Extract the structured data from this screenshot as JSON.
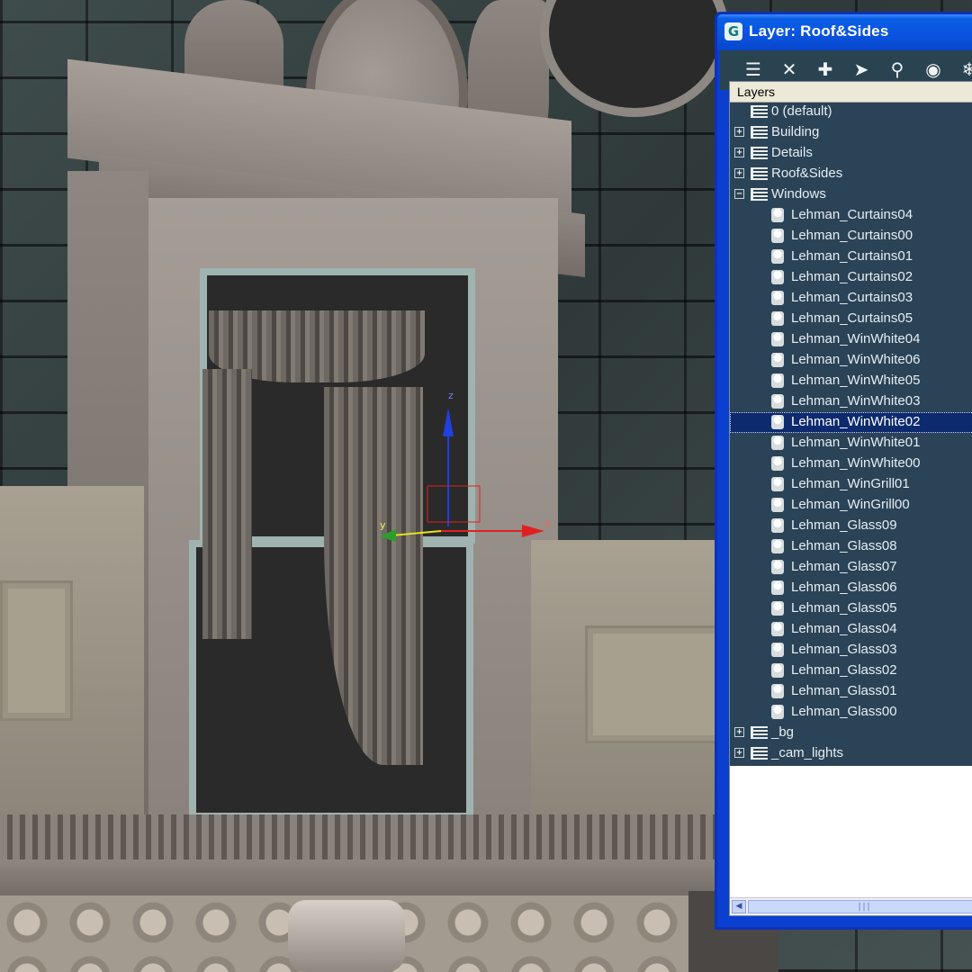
{
  "window": {
    "title": "Layer: Roof&Sides",
    "app_icon": "3dsmax-logo-icon"
  },
  "toolbar": {
    "tools": [
      {
        "name": "create-layer-icon",
        "glyph": "☰"
      },
      {
        "name": "delete-layer-icon",
        "glyph": "✕"
      },
      {
        "name": "add-selection-icon",
        "glyph": "✚"
      },
      {
        "name": "select-objects-icon",
        "glyph": "➤"
      },
      {
        "name": "highlight-selected-icon",
        "glyph": "⚲"
      },
      {
        "name": "hide-all-icon",
        "glyph": "◉"
      },
      {
        "name": "freeze-all-icon",
        "glyph": "❄"
      }
    ]
  },
  "tree": {
    "column_header": "Layers",
    "selected_index": 15,
    "rows": [
      {
        "type": "layer",
        "label": "0 (default)",
        "expander": ""
      },
      {
        "type": "layer",
        "label": "Building",
        "expander": "+"
      },
      {
        "type": "layer",
        "label": "Details",
        "expander": "+"
      },
      {
        "type": "layer",
        "label": "Roof&Sides",
        "expander": "+"
      },
      {
        "type": "layer",
        "label": "Windows",
        "expander": "−"
      },
      {
        "type": "object",
        "label": "Lehman_Curtains04"
      },
      {
        "type": "object",
        "label": "Lehman_Curtains00"
      },
      {
        "type": "object",
        "label": "Lehman_Curtains01"
      },
      {
        "type": "object",
        "label": "Lehman_Curtains02"
      },
      {
        "type": "object",
        "label": "Lehman_Curtains03"
      },
      {
        "type": "object",
        "label": "Lehman_Curtains05"
      },
      {
        "type": "object",
        "label": "Lehman_WinWhite04"
      },
      {
        "type": "object",
        "label": "Lehman_WinWhite06"
      },
      {
        "type": "object",
        "label": "Lehman_WinWhite05"
      },
      {
        "type": "object",
        "label": "Lehman_WinWhite03"
      },
      {
        "type": "object",
        "label": "Lehman_WinWhite02"
      },
      {
        "type": "object",
        "label": "Lehman_WinWhite01"
      },
      {
        "type": "object",
        "label": "Lehman_WinWhite00"
      },
      {
        "type": "object",
        "label": "Lehman_WinGrill01"
      },
      {
        "type": "object",
        "label": "Lehman_WinGrill00"
      },
      {
        "type": "object",
        "label": "Lehman_Glass09"
      },
      {
        "type": "object",
        "label": "Lehman_Glass08"
      },
      {
        "type": "object",
        "label": "Lehman_Glass07"
      },
      {
        "type": "object",
        "label": "Lehman_Glass06"
      },
      {
        "type": "object",
        "label": "Lehman_Glass05"
      },
      {
        "type": "object",
        "label": "Lehman_Glass04"
      },
      {
        "type": "object",
        "label": "Lehman_Glass03"
      },
      {
        "type": "object",
        "label": "Lehman_Glass02"
      },
      {
        "type": "object",
        "label": "Lehman_Glass01"
      },
      {
        "type": "object",
        "label": "Lehman_Glass00"
      },
      {
        "type": "layer",
        "label": "_bg",
        "expander": "+"
      },
      {
        "type": "layer",
        "label": "_cam_lights",
        "expander": "+"
      }
    ]
  },
  "scrollbar": {
    "grip": "|||"
  },
  "gizmo": {
    "x_label": "x",
    "y_label": "y",
    "z_label": "z"
  },
  "colors": {
    "titlebar": "#0a52de",
    "tree_background": "#2b4356",
    "selection": "#0d2a6e",
    "gizmo_x": "#e02020",
    "gizmo_y": "#e8e020",
    "gizmo_z": "#2040e0"
  }
}
